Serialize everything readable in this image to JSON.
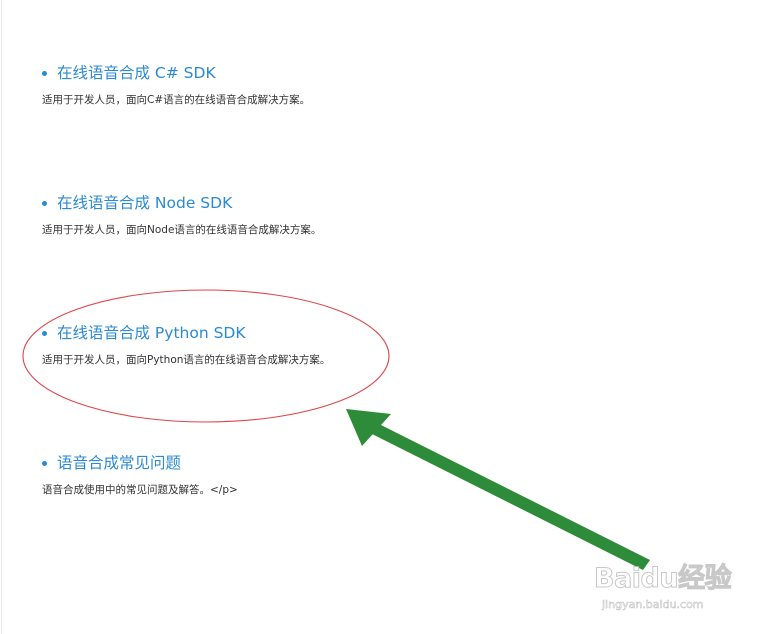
{
  "items": [
    {
      "title": "在线语音合成 C# SDK",
      "description": "适用于开发人员，面向C#语言的在线语音合成解决方案。"
    },
    {
      "title": "在线语音合成 Node SDK",
      "description": "适用于开发人员，面向Node语言的在线语音合成解决方案。"
    },
    {
      "title": "在线语音合成 Python SDK",
      "description": "适用于开发人员，面向Python语言的在线语音合成解决方案。"
    },
    {
      "title": "语音合成常见问题",
      "description": "语音合成使用中的常见问题及解答。</p>"
    }
  ],
  "annotations": {
    "highlight_color": "#e0454a",
    "arrow_color": "#2e8b3a"
  },
  "watermark": {
    "logo": "Baidu经验",
    "url": "jingyan.baidu.com"
  },
  "colors": {
    "link": "#2a8ad4",
    "text": "#333333"
  }
}
